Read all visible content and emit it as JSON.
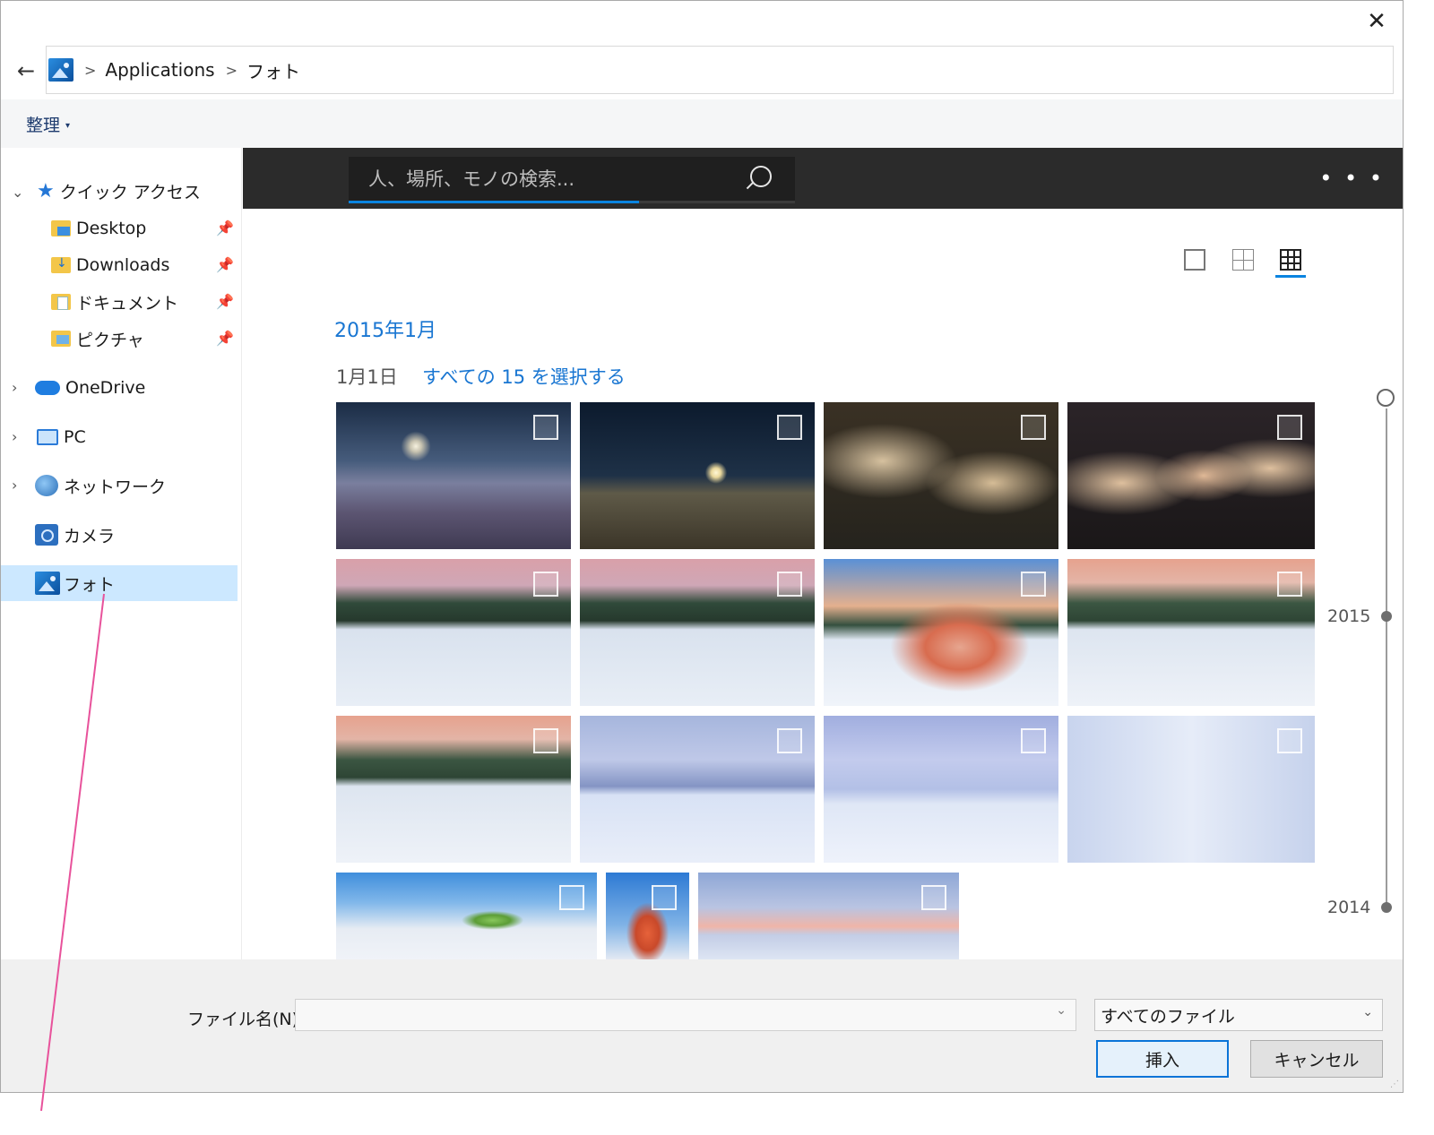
{
  "window": {
    "close_label": "✕"
  },
  "address": {
    "back_label": "←",
    "separator": ">",
    "crumbs": [
      "Applications",
      "フォト"
    ]
  },
  "toolbar": {
    "organize_label": "整理",
    "organize_caret": "▾"
  },
  "nav": {
    "quick_access": {
      "label": "クイック アクセス",
      "items": [
        "Desktop",
        "Downloads",
        "ドキュメント",
        "ピクチャ"
      ]
    },
    "onedrive": "OneDrive",
    "pc": "PC",
    "network": "ネットワーク",
    "camera": "カメラ",
    "photos": "フォト"
  },
  "photos_app": {
    "search_placeholder": "人、場所、モノの検索...",
    "more_label": "• • •",
    "month_heading": "2015年1月",
    "day_label": "1月1日",
    "select_all_label": "すべての 15 を選択する",
    "timeline": {
      "years": [
        "2015",
        "2014"
      ]
    }
  },
  "footer": {
    "filename_label": "ファイル名(N):",
    "filename_value": "",
    "filetype_value": "すべてのファイル",
    "insert_label": "挿入",
    "cancel_label": "キャンセル"
  },
  "colors": {
    "accent": "#0a84e0",
    "link": "#1976d2",
    "nav_selected": "#cce8ff",
    "annotation": "#e8529b"
  }
}
